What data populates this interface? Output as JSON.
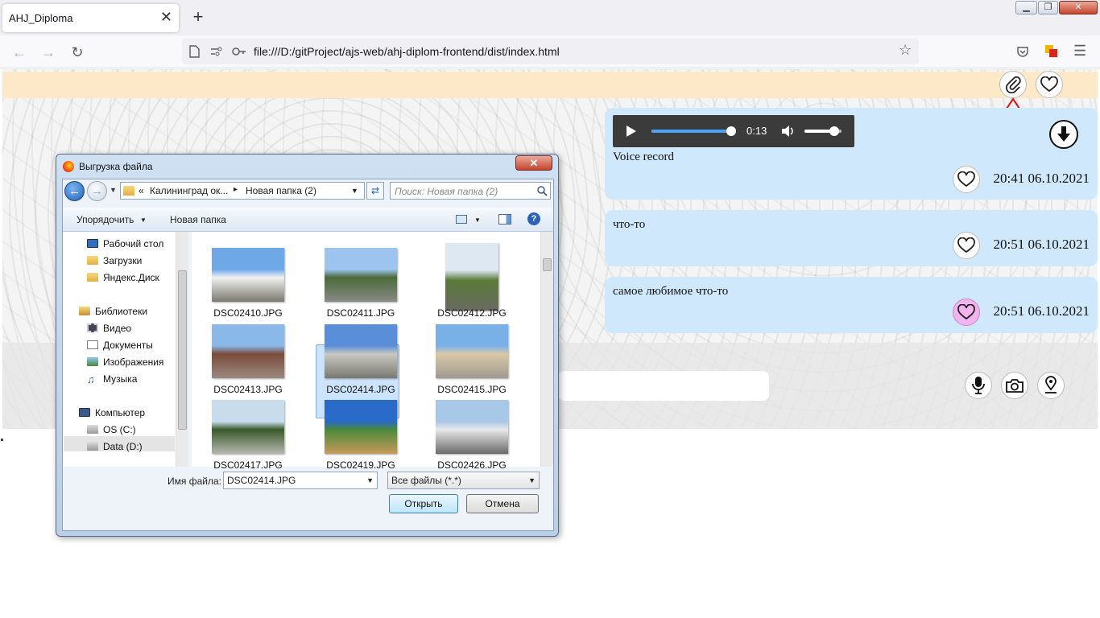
{
  "browser": {
    "tab_title": "AHJ_Diploma",
    "tab_close": "✕",
    "new_tab": "+",
    "url": "file:///D:/gitProject/ajs-web/ahj-diplom-frontend/dist/index.html",
    "window_buttons": [
      "▁",
      "❐",
      "✕"
    ]
  },
  "chat": {
    "messages": [
      {
        "type": "audio",
        "current_time": "0:13",
        "progress_fraction": 0.97,
        "volume_fraction": 0.8,
        "text": "Voice record",
        "time": "20:41 06.10.2021",
        "favorite": false
      },
      {
        "type": "text",
        "text": "что-то",
        "time": "20:51 06.10.2021",
        "favorite": false
      },
      {
        "type": "text",
        "text": "самое любимое что-то",
        "time": "20:51 06.10.2021",
        "favorite": true
      }
    ]
  },
  "dialog": {
    "title": "Выгрузка файла",
    "close": "✕",
    "breadcrumb": [
      "«",
      "Калининград ок...",
      "▸",
      "Новая папка (2)"
    ],
    "search_placeholder": "Поиск: Новая папка (2)",
    "organize": "Упорядочить",
    "new_folder": "Новая папка",
    "nav_items": [
      {
        "label": "Рабочий стол",
        "icon": "desktop-icon"
      },
      {
        "label": "Загрузки",
        "icon": "folder-icon"
      },
      {
        "label": "Яндекс.Диск",
        "icon": "folder-icon"
      },
      {
        "label": "Библиотеки",
        "icon": "library-icon"
      },
      {
        "label": "Видео",
        "icon": "video-icon"
      },
      {
        "label": "Документы",
        "icon": "documents-icon"
      },
      {
        "label": "Изображения",
        "icon": "images-icon"
      },
      {
        "label": "Музыка",
        "icon": "music-icon"
      },
      {
        "label": "Компьютер",
        "icon": "computer-icon"
      },
      {
        "label": "OS (C:)",
        "icon": "drive-icon"
      },
      {
        "label": "Data (D:)",
        "icon": "drive-icon"
      }
    ],
    "files": [
      "DSC02410.JPG",
      "DSC02411.JPG",
      "DSC02412.JPG",
      "DSC02413.JPG",
      "DSC02414.JPG",
      "DSC02415.JPG",
      "DSC02417.JPG",
      "DSC02419.JPG",
      "DSC02426.JPG"
    ],
    "selected_file": "DSC02414.JPG",
    "filename_label": "Имя файла:",
    "filename_value": "DSC02414.JPG",
    "filter_value": "Все файлы (*.*)",
    "open_button": "Открыть",
    "cancel_button": "Отмена"
  }
}
